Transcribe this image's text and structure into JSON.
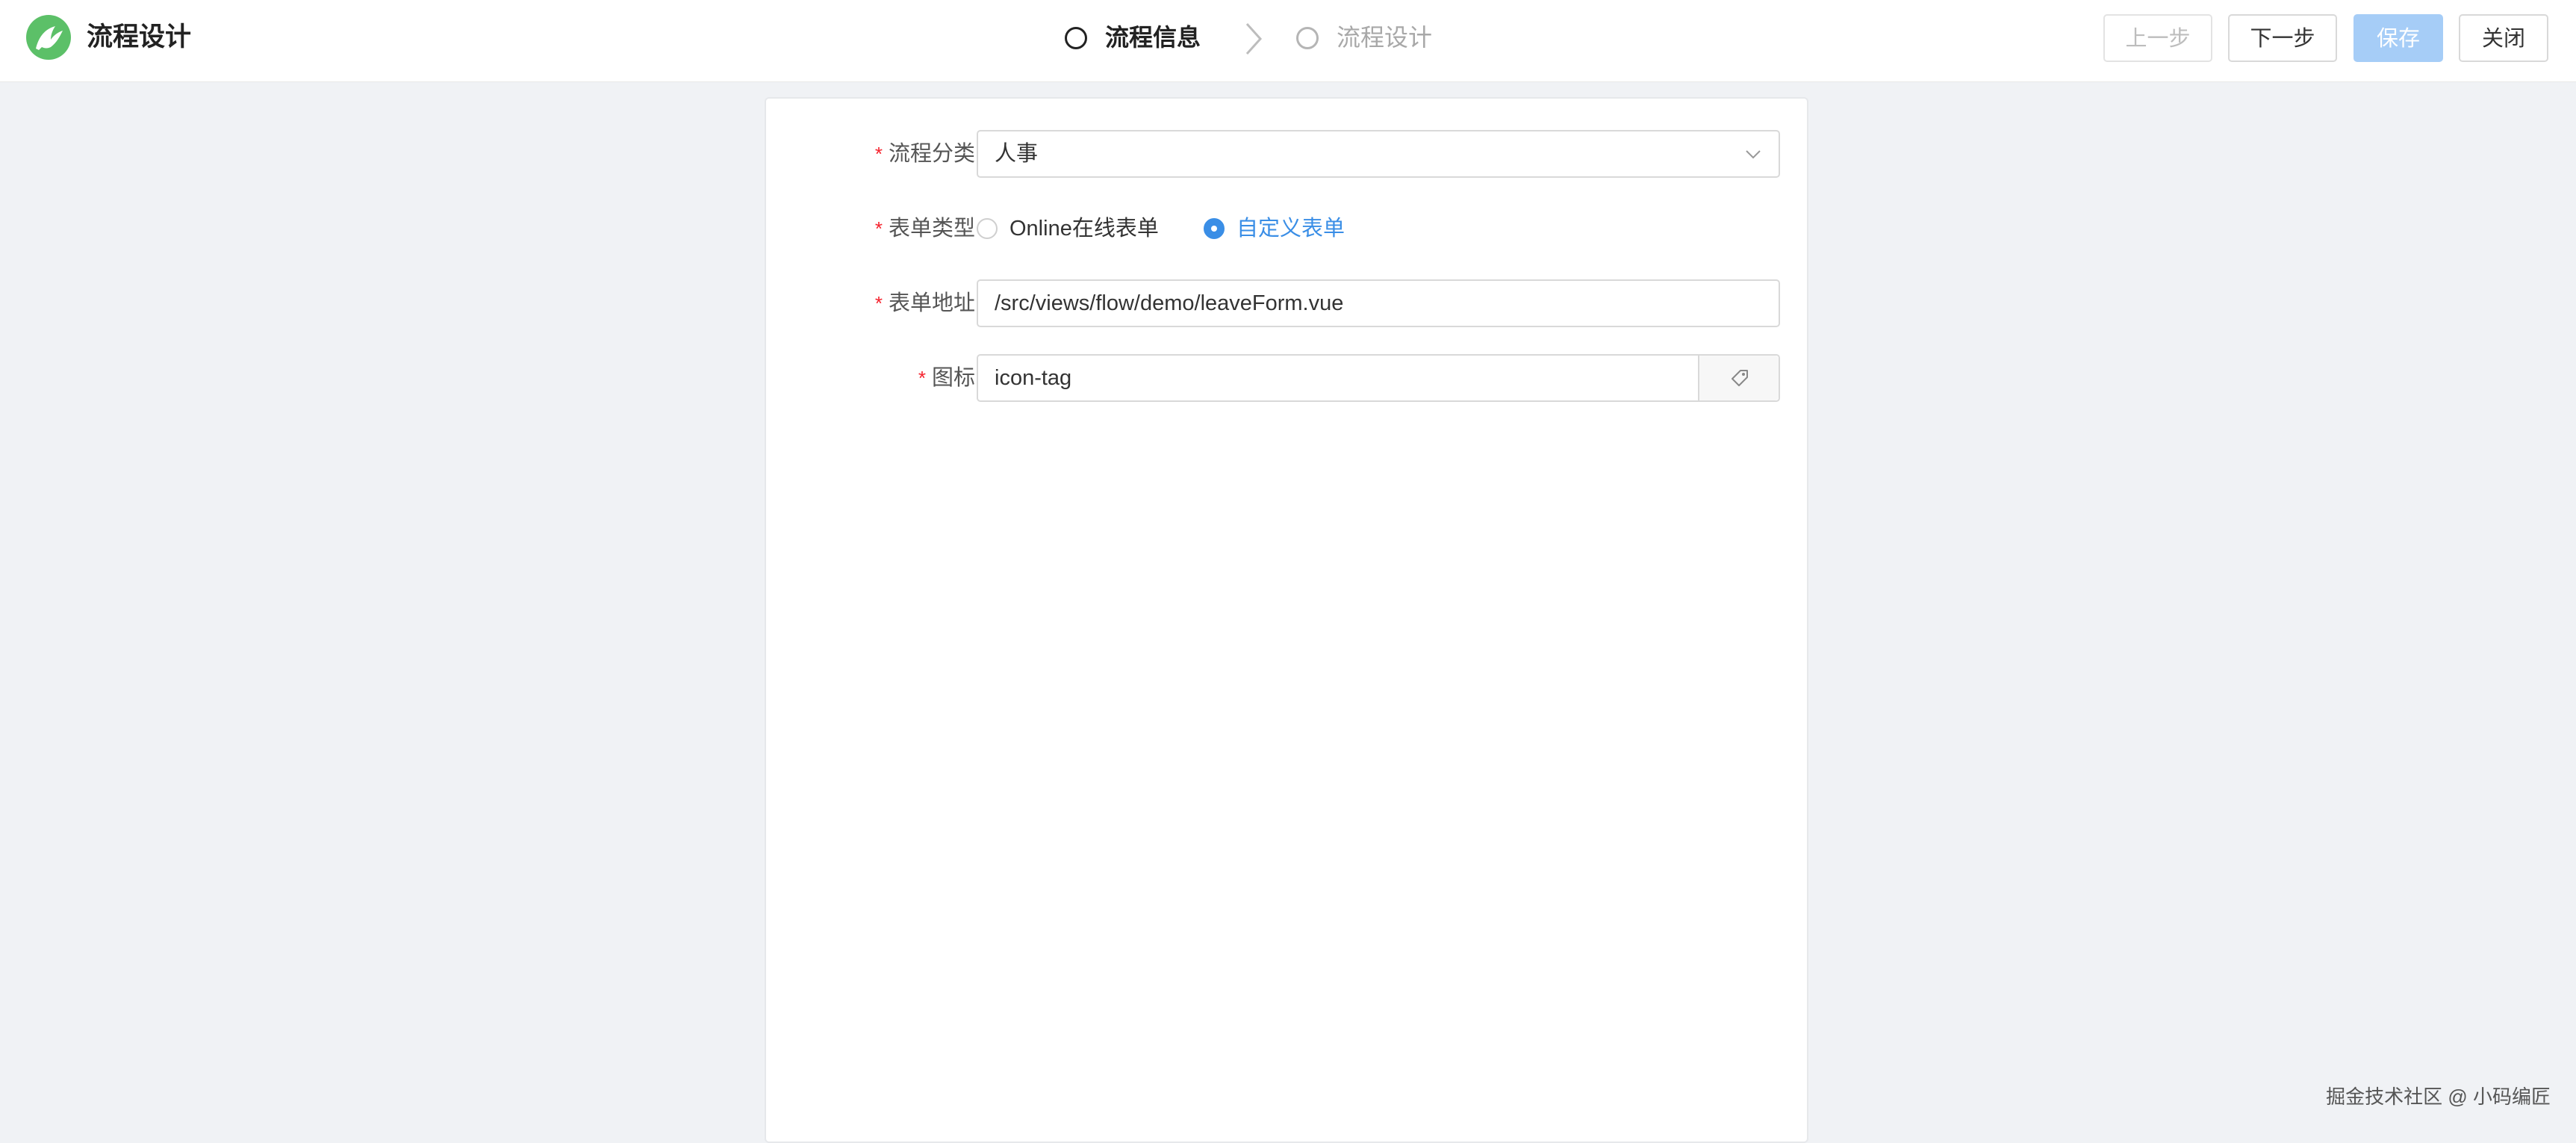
{
  "header": {
    "title": "流程设计",
    "logo_icon": "leaf-logo-icon",
    "brand_color": "#5cc068"
  },
  "steps": [
    {
      "label": "流程信息",
      "state": "active"
    },
    {
      "label": "流程设计",
      "state": "inactive"
    }
  ],
  "toolbar": {
    "prev_label": "上一步",
    "next_label": "下一步",
    "save_label": "保存",
    "close_label": "关闭",
    "save_color": "#a6cdf7"
  },
  "form": {
    "category": {
      "label": "流程分类",
      "value": "人事"
    },
    "form_type": {
      "label": "表单类型",
      "options": [
        "Online在线表单",
        "自定义表单"
      ],
      "selected": "自定义表单"
    },
    "form_url": {
      "label": "表单地址",
      "value": "/src/views/flow/demo/leaveForm.vue"
    },
    "icon": {
      "label": "图标",
      "value": "icon-tag",
      "addon_icon": "tag-icon"
    },
    "required_mark": "*"
  },
  "watermark": "掘金技术社区 @ 小码编匠",
  "colors": {
    "accent": "#3a8ee6",
    "required": "#f5222d",
    "background": "#f0f2f5"
  }
}
